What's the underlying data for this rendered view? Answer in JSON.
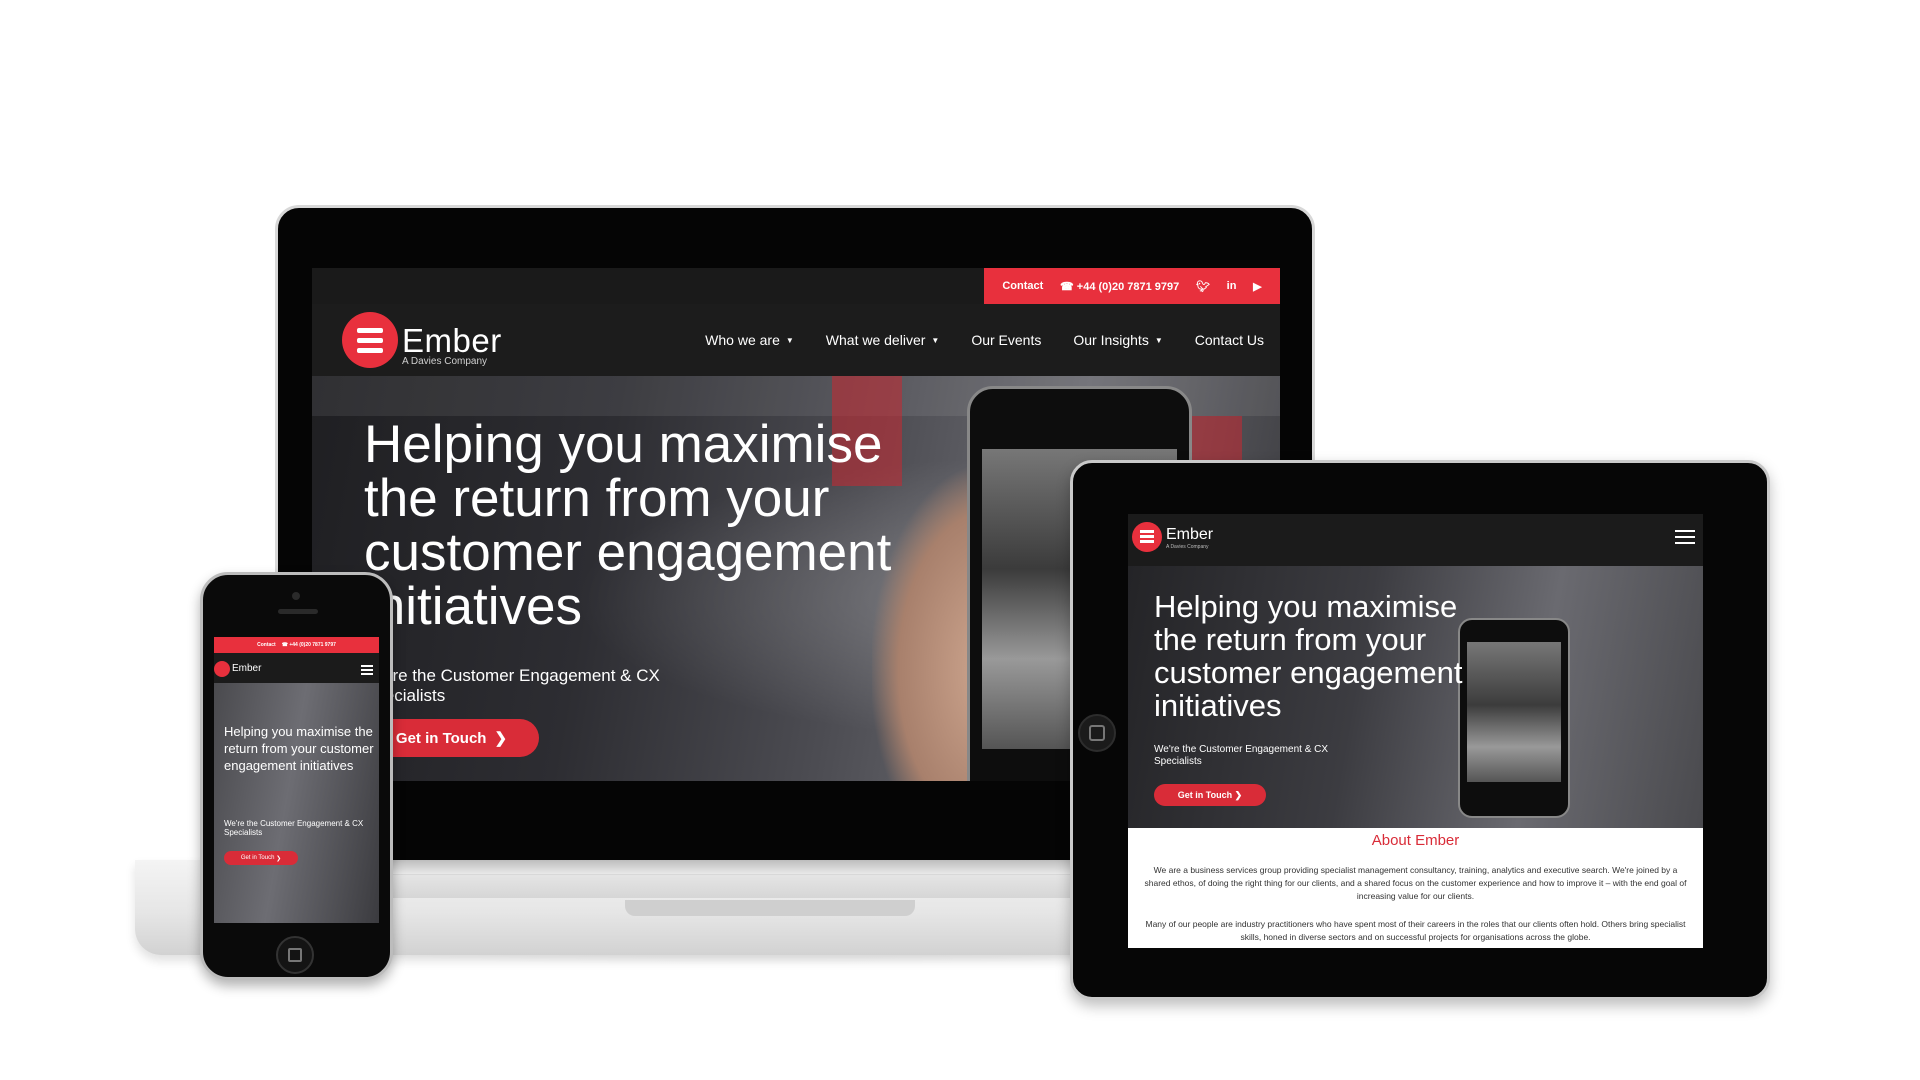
{
  "brand": {
    "name": "Ember",
    "tagline": "A Davies Company",
    "accent": "#e8303d"
  },
  "topbar": {
    "contact_label": "Contact",
    "phone": "☎ +44 (0)20 7871 9797",
    "social_icons": [
      "twitter-icon",
      "linkedin-icon",
      "youtube-icon"
    ]
  },
  "nav": {
    "items": [
      {
        "label": "Who we are",
        "has_dropdown": true
      },
      {
        "label": "What we deliver",
        "has_dropdown": true
      },
      {
        "label": "Our Events",
        "has_dropdown": false
      },
      {
        "label": "Our Insights",
        "has_dropdown": true
      },
      {
        "label": "Contact Us",
        "has_dropdown": false
      }
    ]
  },
  "hero": {
    "title": "Helping you maximise the return from your customer engagement initiatives",
    "subtitle": "We're the Customer Engagement & CX Specialists",
    "button_label": "Get in Touch"
  },
  "about": {
    "heading": "About Ember",
    "paragraph1": "We are a business services group providing specialist management consultancy, training, analytics and executive search. We're joined by a shared ethos, of doing the right thing for our clients, and a shared focus on the customer experience and how to improve it – with the end goal of increasing value for our clients.",
    "paragraph2": "Many of our people are industry practitioners who have spent most of their careers in the roles that our clients often hold. Others bring specialist skills, honed in diverse sectors and on successful projects for organisations across the globe."
  }
}
